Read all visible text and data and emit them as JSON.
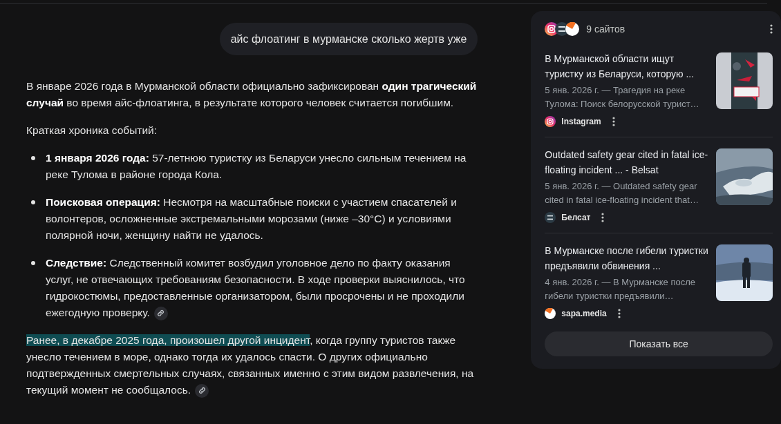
{
  "query": "айс флоатинг в мурманске сколько жертв уже",
  "answer": {
    "intro": "В январе 2026 года в Мурманской области официально зафиксирован **один трагический случай** во время айс-флоатинга, в результате которого человек считается погибшим.",
    "subhead": "Краткая хроника событий:",
    "list": [
      {
        "text": "**1 января 2026 года:** 57-летнюю туристку из Беларуси унесло сильным течением на реке Тулома в районе города Кола.",
        "source_link": false
      },
      {
        "text": "**Поисковая операция:** Несмотря на масштабные поиски с участием спасателей и волонтеров, осложненные экстремальными морозами (ниже –30°C) и условиями полярной ночи, женщину найти не удалось.",
        "source_link": false
      },
      {
        "text": "**Следствие:** Следственный комитет возбудил уголовное дело по факту оказания услуг, не отвечающих требованиям безопасности. В ходе проверки выяснилось, что гидрокостюмы, предоставленные организатором, были просрочены и не проходили ежегодную проверку.",
        "source_link": true
      }
    ],
    "closing": {
      "segments": [
        {
          "text": "Ранее, в декабре 2025 года, произошел другой инцидент",
          "highlighted": true
        },
        {
          "text": ", когда группу туристов также унесло течением в море, однако тогда их удалось спасти. О других официально подтвержденных смертельных случаях, связанных именно с этим видом развлечения, на текущий момент не сообщалось.",
          "highlighted": false
        }
      ],
      "source_link": true
    }
  },
  "sources": {
    "logos": [
      {
        "kind": "instagram"
      },
      {
        "kind": "belsat"
      },
      {
        "kind": "sapa"
      }
    ],
    "count": "9 сайтов",
    "items": [
      {
        "title": "В Мурманской области ищут туристку из Беларуси, которую ...",
        "snippet": "5 янв. 2026 г. — Трагедия на реке Тулома: Поиск белорусской турист…",
        "source": "Instagram",
        "logo": {
          "kind": "instagram"
        }
      },
      {
        "title": "Outdated safety gear cited in fatal ice-floating incident ... - Belsat",
        "snippet": "5 янв. 2026 г. — Outdated safety gear cited in fatal ice-floating incident that…",
        "source": "Белсат",
        "logo": {
          "kind": "belsat"
        }
      },
      {
        "title": "В Мурманске после гибели туристки предъявили обвинения ...",
        "snippet": "4 янв. 2026 г. — В Мурманске после гибели туристки предъявили…",
        "source": "sapa.media",
        "logo": {
          "kind": "sapa"
        }
      }
    ],
    "show_all": "Показать все"
  }
}
